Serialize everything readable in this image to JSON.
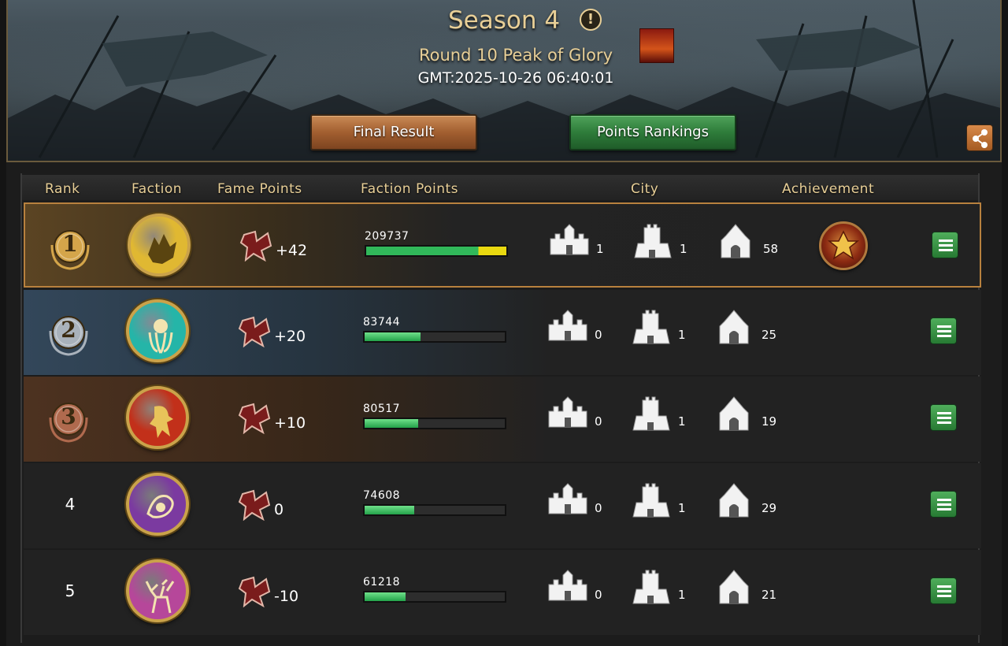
{
  "header": {
    "season_title": "Season 4",
    "info_icon_glyph": "!",
    "round_title": "Round 10 Peak of Glory",
    "gmt_time": "GMT:2025-10-26 06:40:01",
    "buttons": {
      "final_result": "Final Result",
      "points_rankings": "Points Rankings"
    },
    "icons": {
      "info": "info-icon",
      "share": "share-icon",
      "round_badge": "round-badge-icon"
    }
  },
  "table": {
    "columns": {
      "rank": "Rank",
      "faction": "Faction",
      "fame_points": "Fame Points",
      "faction_points": "Faction Points",
      "city": "City",
      "achievement": "Achievement"
    },
    "max_faction_points": 209737,
    "rows": [
      {
        "rank": "1",
        "faction_icon": "direwolf-icon",
        "emblem_color": "#e0b832",
        "fame": "+42",
        "faction_points": "209737",
        "points_value": 209737,
        "city_a": "1",
        "city_b": "1",
        "city_c": "58",
        "achievement": "achievement-badge-icon"
      },
      {
        "rank": "2",
        "faction_icon": "kraken-icon",
        "emblem_color": "#25b5a8",
        "fame": "+20",
        "faction_points": "83744",
        "points_value": 83744,
        "city_a": "0",
        "city_b": "1",
        "city_c": "25",
        "achievement": ""
      },
      {
        "rank": "3",
        "faction_icon": "lion-icon",
        "emblem_color": "#c2301a",
        "fame": "+10",
        "faction_points": "80517",
        "points_value": 80517,
        "city_a": "0",
        "city_b": "1",
        "city_c": "19",
        "achievement": ""
      },
      {
        "rank": "4",
        "faction_icon": "dragon-icon",
        "emblem_color": "#7b3aa0",
        "fame": "0",
        "faction_points": "74608",
        "points_value": 74608,
        "city_a": "0",
        "city_b": "1",
        "city_c": "29",
        "achievement": ""
      },
      {
        "rank": "5",
        "faction_icon": "stag-icon",
        "emblem_color": "#b6479a",
        "fame": "-10",
        "faction_points": "61218",
        "points_value": 61218,
        "city_a": "0",
        "city_b": "1",
        "city_c": "21",
        "achievement": ""
      }
    ]
  },
  "colors": {
    "gold_text": "#e8cf97",
    "medal_gold": "#d4a54a",
    "medal_silver": "#a9b2bb",
    "medal_bronze": "#b06a4e",
    "bar_green": "#31b85a",
    "bar_yellow": "#e9d810"
  }
}
